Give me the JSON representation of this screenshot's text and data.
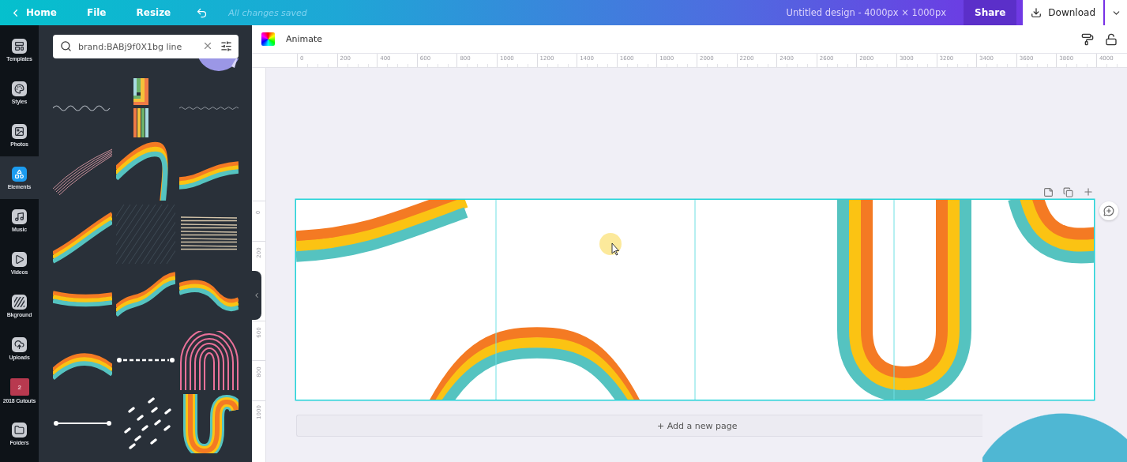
{
  "topbar": {
    "home": "Home",
    "menu": [
      "File",
      "Resize"
    ],
    "status": "All changes saved",
    "title": "Untitled design - 4000px × 1000px",
    "share": "Share",
    "download": "Download"
  },
  "rail": [
    {
      "label": "Templates",
      "kind": "layout",
      "selected": false
    },
    {
      "label": "Styles",
      "kind": "palette",
      "selected": false
    },
    {
      "label": "Photos",
      "kind": "image",
      "selected": false
    },
    {
      "label": "Elements",
      "kind": "shapes",
      "selected": true
    },
    {
      "label": "Music",
      "kind": "music",
      "selected": false
    },
    {
      "label": "Videos",
      "kind": "play",
      "selected": false
    },
    {
      "label": "Bkground",
      "kind": "hatch",
      "selected": false
    },
    {
      "label": "Uploads",
      "kind": "upload",
      "selected": false
    },
    {
      "label": "2018 Cutouts",
      "kind": "badge",
      "badge": "2",
      "selected": false
    },
    {
      "label": "Folders",
      "kind": "folder",
      "selected": false
    }
  ],
  "search": {
    "value": "brand:BABj9f0X1bg line"
  },
  "elements": [
    {
      "kind": "empty"
    },
    {
      "kind": "empty"
    },
    {
      "kind": "sticker"
    },
    {
      "kind": "wavy-line"
    },
    {
      "kind": "stripes"
    },
    {
      "kind": "wavy-thin"
    },
    {
      "kind": "pink-lines"
    },
    {
      "kind": "rainbow-hook"
    },
    {
      "kind": "rainbow-wave"
    },
    {
      "kind": "rainbow-diagonal"
    },
    {
      "kind": "dark-hatch"
    },
    {
      "kind": "sketch-lines"
    },
    {
      "kind": "rainbow-flat"
    },
    {
      "kind": "rainbow-rise"
    },
    {
      "kind": "rainbow-dip"
    },
    {
      "kind": "rainbow-arc"
    },
    {
      "kind": "dotted-line"
    },
    {
      "kind": "pink-arches"
    },
    {
      "kind": "line-dots"
    },
    {
      "kind": "dashes"
    },
    {
      "kind": "rainbow-s"
    }
  ],
  "toolbar": {
    "animate": "Animate"
  },
  "ruler": {
    "x_labels": [
      "0",
      "200",
      "400",
      "600",
      "800",
      "1000",
      "1200",
      "1400",
      "1600",
      "1800",
      "2000",
      "2200",
      "2400",
      "2600",
      "2800",
      "3000",
      "3200",
      "3400",
      "3600",
      "3800",
      "4000"
    ],
    "y_labels": [
      "0",
      "200",
      "600",
      "800",
      "1000"
    ]
  },
  "add_page": "+ Add a new page"
}
